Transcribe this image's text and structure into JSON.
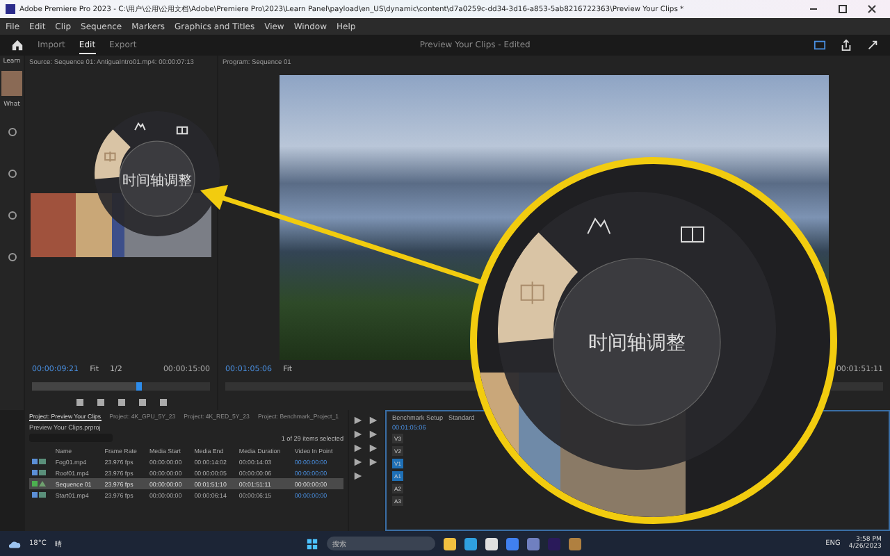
{
  "window": {
    "title": "Adobe Premiere Pro 2023 - C:\\用户\\公用\\公用文档\\Adobe\\Premiere Pro\\2023\\Learn Panel\\payload\\en_US\\dynamic\\content\\d7a0259c-dd34-3d16-a853-5ab8216722363\\Preview Your Clips *"
  },
  "menu": [
    "File",
    "Edit",
    "Clip",
    "Sequence",
    "Markers",
    "Graphics and Titles",
    "View",
    "Window",
    "Help"
  ],
  "workspace_tabs": [
    {
      "label": "Import",
      "selected": false
    },
    {
      "label": "Edit",
      "selected": true
    },
    {
      "label": "Export",
      "selected": false
    }
  ],
  "document_title": "Preview Your Clips - Edited",
  "learn_panel": {
    "title": "Learn",
    "heading": "What"
  },
  "source_monitor": {
    "title": "Source: Sequence 01: AntiguaIntro01.mp4: 00:00:07:13",
    "timecode": "00:00:09:21",
    "zoom": "Fit",
    "resolution": "1/2",
    "duration": "00:00:15:00",
    "level": 0.6
  },
  "program_monitor": {
    "title": "Program: Sequence 01",
    "timecode": "00:01:05:06",
    "zoom": "Fit",
    "duration": "00:01:51:11"
  },
  "radial_menu": {
    "label": "时间轴调整",
    "items": [
      {
        "kind": "timeline",
        "selected": true
      },
      {
        "kind": "color",
        "selected": false
      },
      {
        "kind": "library",
        "selected": false
      }
    ]
  },
  "magnified_radial_menu": {
    "label": "时间轴调整",
    "items": [
      {
        "kind": "timeline",
        "selected": true
      },
      {
        "kind": "color",
        "selected": false
      },
      {
        "kind": "library",
        "selected": false
      }
    ]
  },
  "project_panel": {
    "tabs": [
      {
        "label": "Project: Preview Your Clips",
        "selected": true
      },
      {
        "label": "Project: 4K_GPU_5Y_23",
        "selected": false
      },
      {
        "label": "Project: 4K_RED_5Y_23",
        "selected": false
      },
      {
        "label": "Project: Benchmark_Project_1",
        "selected": false
      }
    ],
    "file": "Preview Your Clips.prproj",
    "selection_info": "1 of 29 items selected",
    "columns": [
      "Name",
      "Frame Rate",
      "Media Start",
      "Media End",
      "Media Duration",
      "Video In Point"
    ],
    "rows": [
      {
        "kind": "clip",
        "color": "#5b8fd6",
        "selected": false,
        "cells": [
          "Fog01.mp4",
          "23.976 fps",
          "00:00:00:00",
          "00:00:14:02",
          "00:00:14:03",
          "00:00:00:00"
        ]
      },
      {
        "kind": "clip",
        "color": "#5b8fd6",
        "selected": false,
        "cells": [
          "Roof01.mp4",
          "23.976 fps",
          "00:00:00:00",
          "00:00:00:05",
          "00:00:00:06",
          "00:00:00:00"
        ]
      },
      {
        "kind": "sequence",
        "color": "#4caf50",
        "selected": true,
        "cells": [
          "Sequence 01",
          "23.976 fps",
          "00:00:00:00",
          "00:01:51:10",
          "00:01:51:11",
          "00:00:00:00"
        ]
      },
      {
        "kind": "clip",
        "color": "#5b8fd6",
        "selected": false,
        "cells": [
          "Start01.mp4",
          "23.976 fps",
          "00:00:00:00",
          "00:00:06:14",
          "00:00:06:15",
          "00:00:00:00"
        ]
      }
    ]
  },
  "timeline": {
    "title": "Benchmark Setup",
    "preset": "Standard",
    "timecode": "00:01:05:06",
    "tracks": [
      {
        "label": "V3",
        "targeted": false
      },
      {
        "label": "V2",
        "targeted": false
      },
      {
        "label": "V1",
        "targeted": true
      },
      {
        "label": "A1",
        "targeted": true
      },
      {
        "label": "A2",
        "targeted": false
      },
      {
        "label": "A3",
        "targeted": false
      }
    ]
  },
  "taskbar": {
    "temperature": "18°C",
    "weather": "晴",
    "search_placeholder": "搜索",
    "language": "ENG",
    "time": "3:58 PM",
    "date": "4/26/2023"
  }
}
